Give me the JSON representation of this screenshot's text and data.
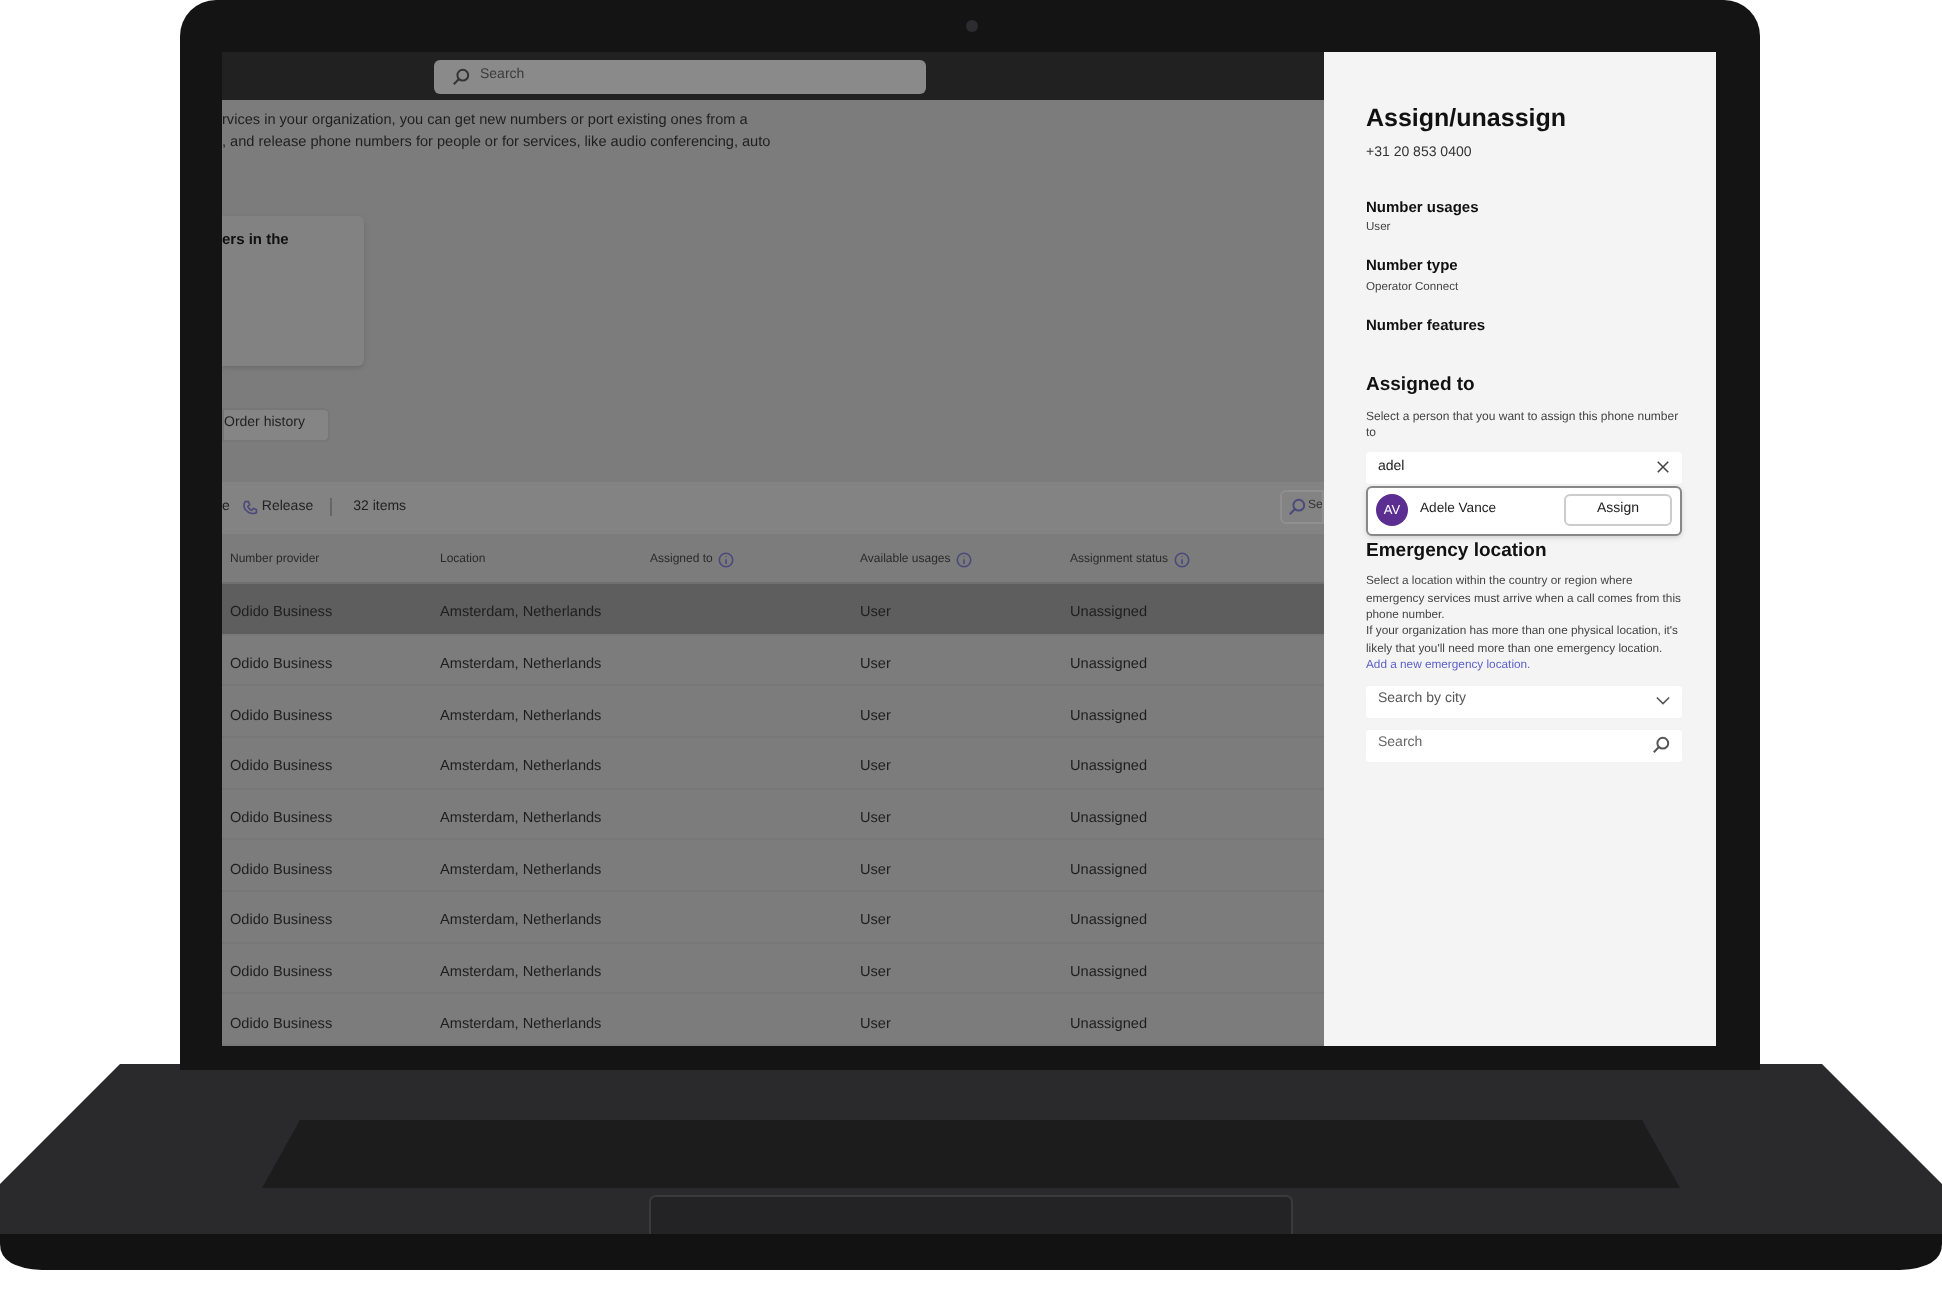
{
  "topbar": {
    "search": {
      "placeholder": "Search"
    }
  },
  "intro": [
    "rvices in your organization, you can get new numbers or port existing ones from a",
    ", and release phone numbers for people or for services, like audio conferencing, auto"
  ],
  "card": {
    "title": "ers in the"
  },
  "order_history_button": "Order history",
  "toolbar": {
    "cut_action": "e",
    "release": "Release",
    "count": "32 items",
    "search": {
      "placeholder": "Se"
    }
  },
  "table": {
    "columns": [
      {
        "label": "Number provider",
        "info": false
      },
      {
        "label": "Location",
        "info": false
      },
      {
        "label": "Assigned to",
        "info": true
      },
      {
        "label": "Available usages",
        "info": true
      },
      {
        "label": "Assignment status",
        "info": true
      }
    ],
    "rows": [
      {
        "selected": true,
        "cells": [
          "Odido Business",
          "Amsterdam, Netherlands",
          "",
          "User",
          "Unassigned"
        ]
      },
      {
        "selected": false,
        "cells": [
          "Odido Business",
          "Amsterdam, Netherlands",
          "",
          "User",
          "Unassigned"
        ]
      },
      {
        "selected": false,
        "cells": [
          "Odido Business",
          "Amsterdam, Netherlands",
          "",
          "User",
          "Unassigned"
        ]
      },
      {
        "selected": false,
        "cells": [
          "Odido Business",
          "Amsterdam, Netherlands",
          "",
          "User",
          "Unassigned"
        ]
      },
      {
        "selected": false,
        "cells": [
          "Odido Business",
          "Amsterdam, Netherlands",
          "",
          "User",
          "Unassigned"
        ]
      },
      {
        "selected": false,
        "cells": [
          "Odido Business",
          "Amsterdam, Netherlands",
          "",
          "User",
          "Unassigned"
        ]
      },
      {
        "selected": false,
        "cells": [
          "Odido Business",
          "Amsterdam, Netherlands",
          "",
          "User",
          "Unassigned"
        ]
      },
      {
        "selected": false,
        "cells": [
          "Odido Business",
          "Amsterdam, Netherlands",
          "",
          "User",
          "Unassigned"
        ]
      },
      {
        "selected": false,
        "cells": [
          "Odido Business",
          "Amsterdam, Netherlands",
          "",
          "User",
          "Unassigned"
        ]
      }
    ]
  },
  "panel": {
    "title": "Assign/unassign",
    "number": "+31 20 853 0400",
    "properties": [
      {
        "label": "Number usages",
        "value": "User"
      },
      {
        "label": "Number type",
        "value": "Operator Connect"
      },
      {
        "label": "Number features"
      }
    ],
    "assigned": {
      "heading": "Assigned to",
      "hint": "Select a person that you want to assign this phone number to",
      "search": {
        "value": "adel"
      },
      "suggestions": [
        {
          "initials": "AV",
          "name": "Adele Vance",
          "action": "Assign"
        }
      ]
    },
    "emergency": {
      "heading": "Emergency location",
      "description": "Select a location within the country or region where emergency services must arrive when a call comes from this phone number.",
      "note": "If your organization has more than one physical location, it's likely that you'll need more than one emergency location.",
      "link": "Add a new emergency location.",
      "city_dropdown": {
        "placeholder": "Search by city"
      },
      "search": {
        "placeholder": "Search"
      }
    }
  }
}
